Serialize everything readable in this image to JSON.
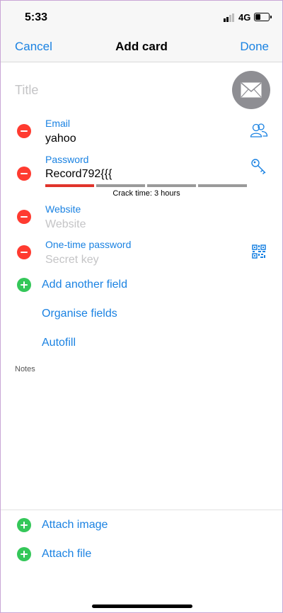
{
  "status_bar": {
    "time": "5:33",
    "network": "4G"
  },
  "nav": {
    "cancel": "Cancel",
    "title": "Add card",
    "done": "Done"
  },
  "title_field": {
    "placeholder": "Title"
  },
  "fields": {
    "email": {
      "label": "Email",
      "value": "yahoo"
    },
    "password": {
      "label": "Password",
      "value": "Record792{{{",
      "crack_time": "Crack time: 3 hours",
      "strength_segments_filled": 1,
      "strength_segments_total": 4
    },
    "website": {
      "label": "Website",
      "placeholder": "Website"
    },
    "otp": {
      "label": "One-time password",
      "placeholder": "Secret key"
    }
  },
  "actions": {
    "add_field": "Add another field",
    "organise": "Organise fields",
    "autofill": "Autofill",
    "attach_image": "Attach image",
    "attach_file": "Attach file"
  },
  "notes_label": "Notes",
  "colors": {
    "accent": "#1a82e2",
    "remove": "#ff3b30",
    "add": "#34c759",
    "strength_filled": "#e0342b",
    "strength_empty": "#9a9a9a"
  },
  "icons": {
    "avatar": "envelope-icon",
    "email_side": "contacts-icon",
    "password_side": "key-icon",
    "otp_side": "qr-code-icon"
  }
}
